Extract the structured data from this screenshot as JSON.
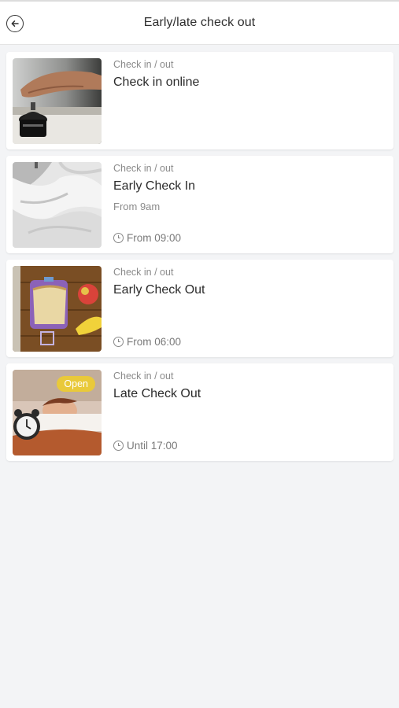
{
  "header": {
    "title": "Early/late check out",
    "back_icon": "arrow-left-circle-icon"
  },
  "cards": [
    {
      "category": "Check in / out",
      "name": "Check in online",
      "subtitle": "",
      "time": "",
      "badge": "",
      "image": "hand-on-bell-photo"
    },
    {
      "category": "Check in / out",
      "name": "Early Check In",
      "subtitle": "From 9am",
      "time": "From 09:00",
      "badge": "",
      "image": "bed-sheets-photo"
    },
    {
      "category": "Check in / out",
      "name": "Early Check Out",
      "subtitle": "",
      "time": "From 06:00",
      "badge": "",
      "image": "lunchbox-photo"
    },
    {
      "category": "Check in / out",
      "name": "Late Check Out",
      "subtitle": "",
      "time": "Until 17:00",
      "badge": "Open",
      "image": "alarm-clock-sleeping-photo"
    }
  ],
  "colors": {
    "background": "#f3f4f6",
    "card": "#ffffff",
    "badge": "#e9c93a",
    "muted_text": "#8a8a8a"
  }
}
